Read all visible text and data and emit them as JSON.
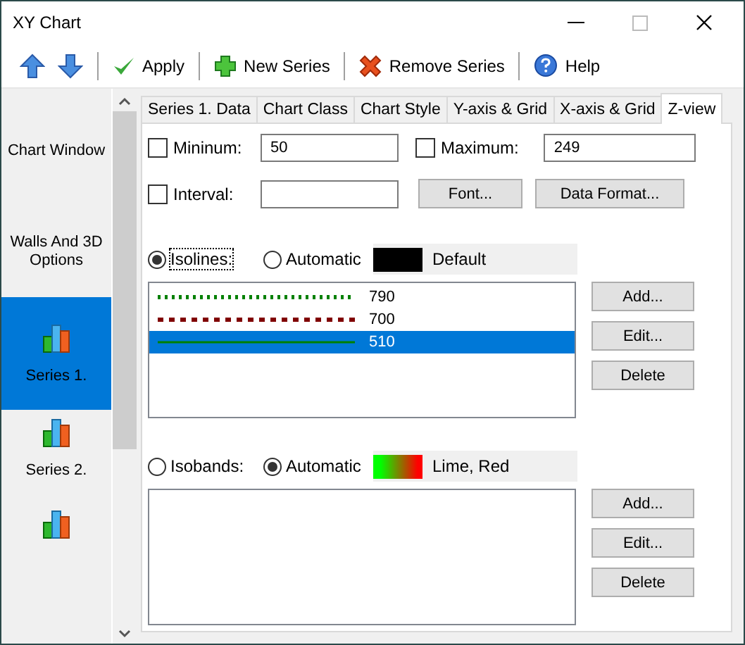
{
  "window": {
    "title": "XY Chart"
  },
  "toolbar": [
    {
      "kind": "up"
    },
    {
      "kind": "down"
    },
    {
      "kind": "sep"
    },
    {
      "kind": "apply",
      "label": "Apply"
    },
    {
      "kind": "sep"
    },
    {
      "kind": "new",
      "label": "New Series"
    },
    {
      "kind": "sep"
    },
    {
      "kind": "remove",
      "label": "Remove Series"
    },
    {
      "kind": "sep"
    },
    {
      "kind": "help",
      "label": "Help"
    }
  ],
  "sidebar": {
    "items": [
      {
        "kind": "text",
        "label": "Chart Window",
        "selected": false
      },
      {
        "kind": "text",
        "label": "Walls And 3D Options",
        "selected": false
      },
      {
        "kind": "series",
        "label": "Series 1.",
        "selected": true
      },
      {
        "kind": "series",
        "label": "Series 2.",
        "selected": false
      },
      {
        "kind": "series",
        "selected": false
      }
    ]
  },
  "tabs": [
    {
      "label": "Series 1. Data",
      "selected": false
    },
    {
      "label": "Chart Class",
      "selected": false
    },
    {
      "label": "Chart Style",
      "selected": false
    },
    {
      "label": "Y-axis & Grid",
      "selected": false
    },
    {
      "label": "X-axis & Grid",
      "selected": false
    },
    {
      "label": "Z-view",
      "selected": true
    }
  ],
  "minimum": {
    "label": "Mininum:",
    "checked": false,
    "value": "50"
  },
  "maximum": {
    "label": "Maximum:",
    "checked": false,
    "value": "249"
  },
  "interval": {
    "label": "Interval:",
    "checked": false
  },
  "font_button": "Font...",
  "data_format_button": "Data Format...",
  "isolines": {
    "mode_label": "Isolines:",
    "selected": true,
    "automatic_label": "Automatic",
    "automatic": false,
    "swatch_label": "Default",
    "items": [
      {
        "color": "#008000",
        "value": "790",
        "selected": false
      },
      {
        "color": "#800000",
        "value": "700",
        "selected": false
      },
      {
        "color": "#008000",
        "value": "510",
        "selected": true
      }
    ],
    "buttons": [
      "Add...",
      "Edit...",
      "Delete"
    ]
  },
  "isobands": {
    "mode_label": "Isobands:",
    "selected": false,
    "automatic_label": "Automatic",
    "automatic": true,
    "swatch_label": "Lime, Red",
    "buttons": [
      "Add...",
      "Edit...",
      "Delete"
    ]
  }
}
